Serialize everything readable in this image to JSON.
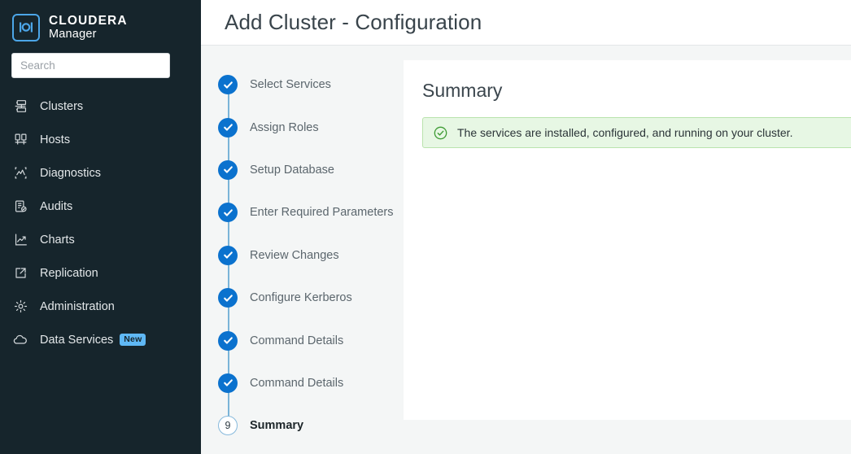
{
  "sidebar": {
    "brand": {
      "logo_icon": "cloudera-logo-icon",
      "line1": "CLOUDERA",
      "line2": "Manager"
    },
    "search": {
      "placeholder": "Search",
      "value": ""
    },
    "items": [
      {
        "label": "Clusters",
        "icon": "clusters-icon"
      },
      {
        "label": "Hosts",
        "icon": "hosts-icon"
      },
      {
        "label": "Diagnostics",
        "icon": "diagnostics-icon"
      },
      {
        "label": "Audits",
        "icon": "audits-icon"
      },
      {
        "label": "Charts",
        "icon": "charts-icon"
      },
      {
        "label": "Replication",
        "icon": "replication-icon"
      },
      {
        "label": "Administration",
        "icon": "gear-icon"
      },
      {
        "label": "Data Services",
        "icon": "cloud-icon",
        "badge": "New"
      }
    ]
  },
  "header": {
    "title": "Add Cluster - Configuration"
  },
  "wizard": {
    "steps": [
      {
        "label": "Select Services",
        "state": "done",
        "marker": "check-icon"
      },
      {
        "label": "Assign Roles",
        "state": "done",
        "marker": "check-icon"
      },
      {
        "label": "Setup Database",
        "state": "done",
        "marker": "check-icon"
      },
      {
        "label": "Enter Required Parameters",
        "state": "done",
        "marker": "check-icon"
      },
      {
        "label": "Review Changes",
        "state": "done",
        "marker": "check-icon"
      },
      {
        "label": "Configure Kerberos",
        "state": "done",
        "marker": "check-icon"
      },
      {
        "label": "Command Details",
        "state": "done",
        "marker": "check-icon"
      },
      {
        "label": "Command Details",
        "state": "done",
        "marker": "check-icon"
      },
      {
        "label": "Summary",
        "state": "current",
        "marker": "9"
      }
    ]
  },
  "panel": {
    "title": "Summary",
    "alert": {
      "icon": "check-circle-icon",
      "message": "The services are installed, configured, and running on your cluster."
    }
  },
  "colors": {
    "sidebar_bg": "#16252c",
    "accent_blue": "#0b72ce",
    "logo_blue": "#4ca6e8",
    "badge_blue": "#5fb8f5",
    "rail_line": "#7ab4d8",
    "success_bg": "#e7f7e4",
    "success_border": "#b9e3ad",
    "success_green": "#3f9c35",
    "content_bg": "#f4f6f6"
  }
}
